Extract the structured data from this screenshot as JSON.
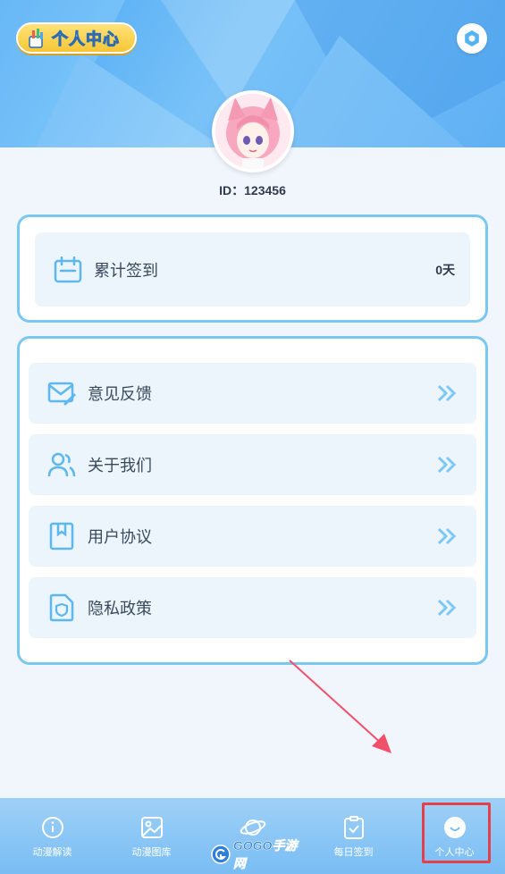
{
  "header": {
    "title": "个人中心",
    "settings_icon": "settings-icon"
  },
  "profile": {
    "id_text": "ID：123456"
  },
  "signin": {
    "label": "累计签到",
    "value": "0天",
    "icon": "calendar-icon"
  },
  "menu": {
    "items": [
      {
        "label": "意见反馈",
        "icon": "mail-edit-icon"
      },
      {
        "label": "关于我们",
        "icon": "users-icon"
      },
      {
        "label": "用户协议",
        "icon": "bookmark-icon"
      },
      {
        "label": "隐私政策",
        "icon": "shield-file-icon"
      }
    ]
  },
  "tabbar": {
    "tabs": [
      {
        "label": "动漫解读",
        "icon": "info-icon"
      },
      {
        "label": "动漫图库",
        "icon": "image-icon"
      },
      {
        "label": "",
        "icon": "planet-icon"
      },
      {
        "label": "每日签到",
        "icon": "clipboard-check-icon"
      },
      {
        "label": "个人中心",
        "icon": "smile-icon"
      }
    ],
    "active_index": 4
  },
  "watermark": {
    "text": "GOGO手游网"
  },
  "colors": {
    "accent": "#7ac7f2",
    "header_blue": "#5fb0f4",
    "highlight_red": "#e5404a",
    "title_yellow": "#f7c634"
  }
}
